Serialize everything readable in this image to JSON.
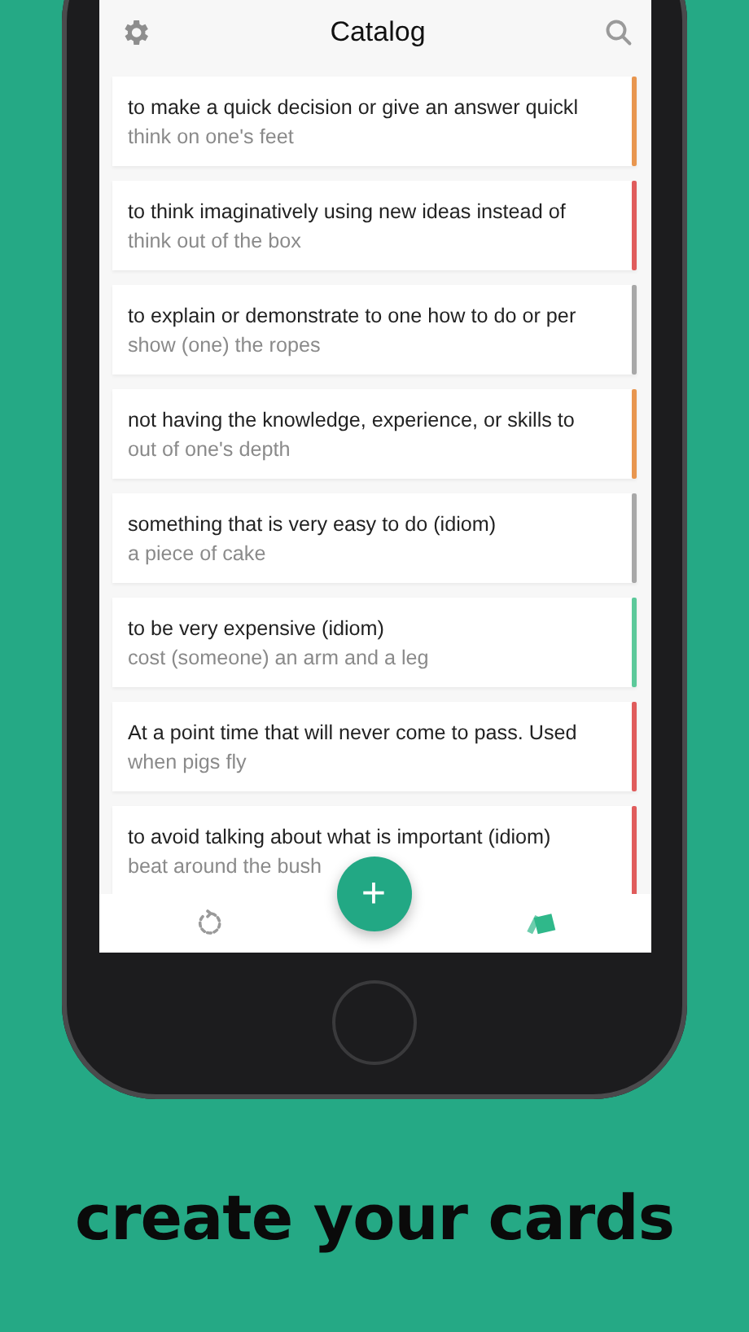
{
  "header": {
    "title": "Catalog"
  },
  "cards": [
    {
      "definition": "to make a quick decision or give an answer quickl",
      "phrase": "think on one's feet",
      "color": "#e8964f"
    },
    {
      "definition": "to think imaginatively using new ideas instead of",
      "phrase": "think out of the box",
      "color": "#e05c5c"
    },
    {
      "definition": "to explain or demonstrate to one how to do or per",
      "phrase": "show (one) the ropes",
      "color": "#a8a8a8"
    },
    {
      "definition": "not having the knowledge, experience, or skills to",
      "phrase": "out of one's depth",
      "color": "#e8964f"
    },
    {
      "definition": "something that is very easy to do (idiom)",
      "phrase": "a piece of cake",
      "color": "#a8a8a8"
    },
    {
      "definition": "to be very expensive (idiom)",
      "phrase": "cost (someone) an arm and a leg",
      "color": "#5cc99a"
    },
    {
      "definition": "At a point time that will never come to pass. Used",
      "phrase": "when pigs fly",
      "color": "#e05c5c"
    },
    {
      "definition": "to avoid talking about what is important (idiom)",
      "phrase": "beat around the bush",
      "color": "#e05c5c"
    }
  ],
  "add_button": {
    "label": "+"
  },
  "nav": [
    {
      "kind": "review",
      "selected": false
    },
    {
      "kind": "cards",
      "selected": true
    }
  ],
  "caption": "create your cards"
}
